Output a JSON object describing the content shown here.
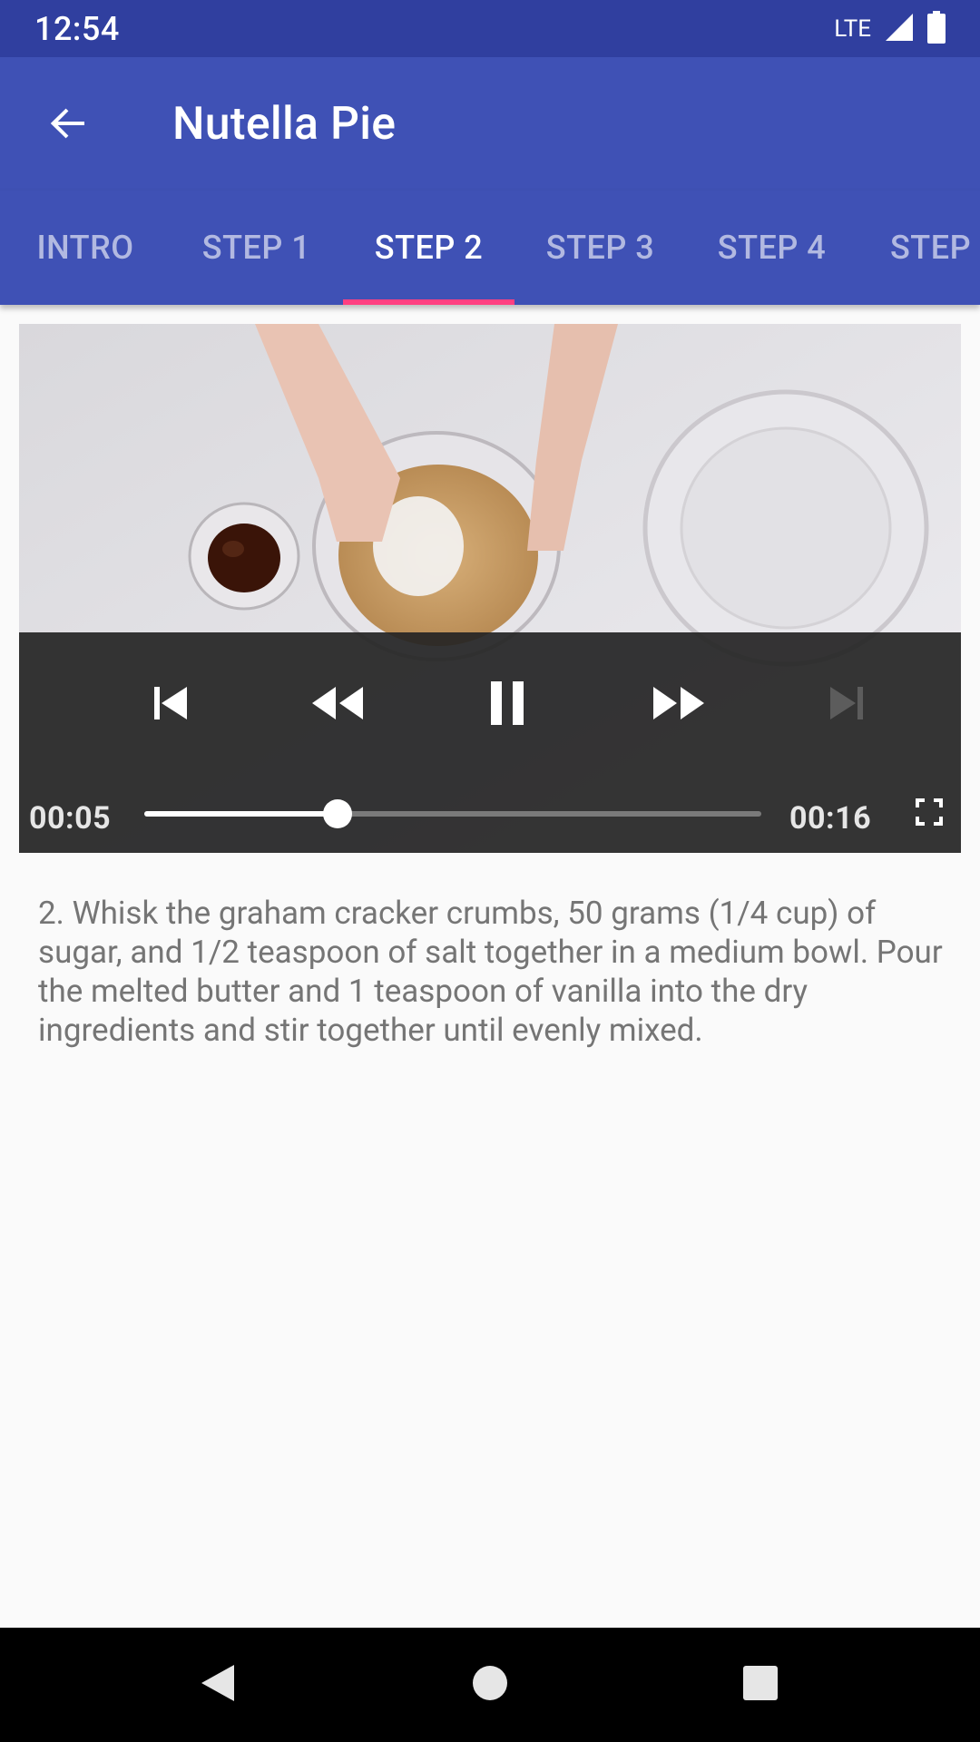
{
  "status_bar": {
    "time": "12:54",
    "network": "LTE"
  },
  "app_bar": {
    "title": "Nutella Pie",
    "back_icon": "arrow-back-icon"
  },
  "tabs": [
    {
      "label": "INTRO",
      "selected": false
    },
    {
      "label": "STEP 1",
      "selected": false
    },
    {
      "label": "STEP 2",
      "selected": true
    },
    {
      "label": "STEP 3",
      "selected": false
    },
    {
      "label": "STEP 4",
      "selected": false
    },
    {
      "label": "STEP",
      "selected": false
    }
  ],
  "player": {
    "current_time": "00:05",
    "duration": "00:16",
    "progress_fraction": 0.3125,
    "controls": [
      "skip-previous-icon",
      "rewind-icon",
      "pause-icon",
      "fast-forward-icon",
      "skip-next-icon"
    ],
    "fullscreen_icon": "fullscreen-icon"
  },
  "step": {
    "description": "2. Whisk the graham cracker crumbs, 50 grams (1/4 cup) of sugar, and 1/2 teaspoon of salt together in a medium bowl. Pour the melted butter and 1 teaspoon of vanilla into the dry ingredients and stir together until evenly mixed."
  },
  "colors": {
    "primary": "#3f51b5",
    "primary_dark": "#303f9f",
    "accent": "#ff4081",
    "body_text": "#757575"
  }
}
